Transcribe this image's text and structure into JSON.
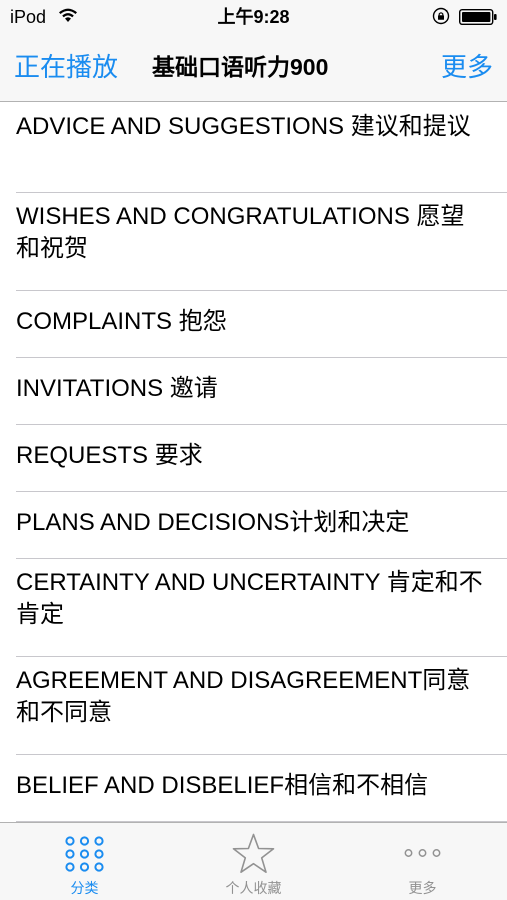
{
  "status_bar": {
    "carrier": "iPod",
    "time": "上午9:28",
    "icons": [
      "wifi-icon",
      "orientation-lock-icon",
      "battery-icon"
    ]
  },
  "nav_bar": {
    "left_button": "正在播放",
    "title": "基础口语听力900",
    "right_button": "更多"
  },
  "list": {
    "items": [
      {
        "label": "ADVICE AND SUGGESTIONS 建议和提议"
      },
      {
        "label": "WISHES AND CONGRATULATIONS 愿望和祝贺"
      },
      {
        "label": "COMPLAINTS 抱怨"
      },
      {
        "label": "INVITATIONS 邀请"
      },
      {
        "label": "REQUESTS 要求"
      },
      {
        "label": "PLANS AND DECISIONS计划和决定"
      },
      {
        "label": "CERTAINTY AND UNCERTAINTY 肯定和不肯定"
      },
      {
        "label": "AGREEMENT AND DISAGREEMENT同意和不同意"
      },
      {
        "label": "BELIEF AND DISBELIEF相信和不相信"
      }
    ]
  },
  "tab_bar": {
    "tabs": [
      {
        "label": "分类",
        "icon": "grid-icon",
        "active": true
      },
      {
        "label": "个人收藏",
        "icon": "star-icon",
        "active": false
      },
      {
        "label": "更多",
        "icon": "more-icon",
        "active": false
      }
    ]
  },
  "colors": {
    "accent": "#1a8cf0",
    "inactive": "#929292",
    "bar_background": "#f7f7f7",
    "separator": "#c8c7cc"
  }
}
